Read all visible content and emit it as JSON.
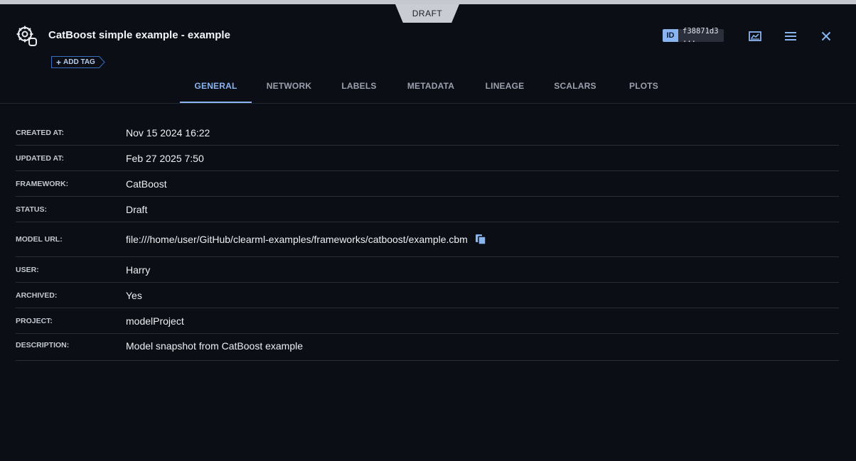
{
  "window": {
    "status_badge": "DRAFT"
  },
  "header": {
    "title": "CatBoost simple example - example",
    "add_tag_label": "ADD TAG",
    "id_chip": "ID",
    "id_value": "f38871d3 ..."
  },
  "tabs": [
    {
      "label": "GENERAL",
      "active": true
    },
    {
      "label": "NETWORK"
    },
    {
      "label": "LABELS"
    },
    {
      "label": "METADATA"
    },
    {
      "label": "LINEAGE"
    },
    {
      "label": "SCALARS"
    },
    {
      "label": "PLOTS"
    }
  ],
  "details": [
    {
      "label": "CREATED AT:",
      "value": "Nov 15 2024 16:22"
    },
    {
      "label": "UPDATED AT:",
      "value": "Feb 27 2025 7:50"
    },
    {
      "label": "FRAMEWORK:",
      "value": "CatBoost"
    },
    {
      "label": "STATUS:",
      "value": "Draft"
    },
    {
      "label": "MODEL URL:",
      "value": "file:///home/user/GitHub/clearml-examples/frameworks/catboost/example.cbm"
    },
    {
      "label": "USER:",
      "value": "Harry"
    },
    {
      "label": "ARCHIVED:",
      "value": "Yes"
    },
    {
      "label": "PROJECT:",
      "value": "modelProject"
    },
    {
      "label": "DESCRIPTION:",
      "value": "Model snapshot from CatBoost example"
    }
  ],
  "icons": {
    "model": "model-icon",
    "info_panel": "chart-panel-icon",
    "menu": "hamburger-menu-icon",
    "close": "close-icon",
    "copy": "copy-icon"
  },
  "colors": {
    "accent": "#8ab4f0",
    "background": "#0b0e15"
  }
}
